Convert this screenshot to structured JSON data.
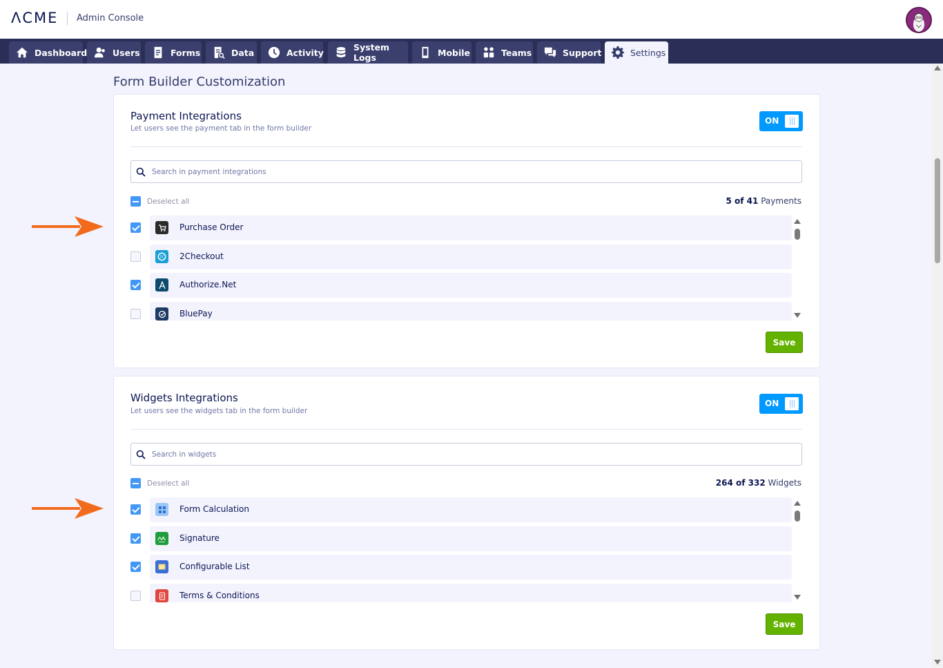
{
  "header": {
    "logo": "ΛCME",
    "console_title": "Admin Console"
  },
  "nav": {
    "tabs": [
      {
        "label": "Dashboard",
        "icon": "home-icon"
      },
      {
        "label": "Users",
        "icon": "users-icon"
      },
      {
        "label": "Forms",
        "icon": "forms-icon"
      },
      {
        "label": "Data",
        "icon": "data-icon"
      },
      {
        "label": "Activity",
        "icon": "clock-icon"
      },
      {
        "label": "System Logs",
        "icon": "database-icon"
      },
      {
        "label": "Mobile",
        "icon": "mobile-icon"
      },
      {
        "label": "Teams",
        "icon": "teams-icon"
      },
      {
        "label": "Support",
        "icon": "support-icon"
      },
      {
        "label": "Settings",
        "icon": "gear-icon",
        "active": true
      }
    ]
  },
  "page": {
    "title": "Form Builder Customization"
  },
  "payments": {
    "title": "Payment Integrations",
    "subtitle": "Let users see the payment tab in the form builder",
    "toggle_label": "ON",
    "search_placeholder": "Search in payment integrations",
    "deselect_label": "Deselect all",
    "count_bold": "5 of 41",
    "count_suffix": " Payments",
    "items": [
      {
        "label": "Purchase Order",
        "checked": true,
        "icon": "cart-icon",
        "icon_color": "#2b2b2b"
      },
      {
        "label": "2Checkout",
        "checked": false,
        "icon": "2checkout-icon",
        "icon_color": "#1a9fd6"
      },
      {
        "label": "Authorize.Net",
        "checked": true,
        "icon": "authorize-net-icon",
        "icon_color": "#0e4c6e"
      },
      {
        "label": "BluePay",
        "checked": false,
        "icon": "bluepay-icon",
        "icon_color": "#1d3b63"
      }
    ],
    "save_label": "Save"
  },
  "widgets": {
    "title": "Widgets Integrations",
    "subtitle": "Let users see the widgets tab in the form builder",
    "toggle_label": "ON",
    "search_placeholder": "Search in widgets",
    "deselect_label": "Deselect all",
    "count_bold": "264 of 332",
    "count_suffix": " Widgets",
    "items": [
      {
        "label": "Form Calculation",
        "checked": true,
        "icon": "calculator-icon",
        "icon_color": "#9cc7f5"
      },
      {
        "label": "Signature",
        "checked": true,
        "icon": "signature-icon",
        "icon_color": "#1f9d3a"
      },
      {
        "label": "Configurable List",
        "checked": true,
        "icon": "list-icon",
        "icon_color": "#3b6fd6"
      },
      {
        "label": "Terms & Conditions",
        "checked": false,
        "icon": "terms-icon",
        "icon_color": "#e0473f"
      }
    ],
    "save_label": "Save"
  },
  "colors": {
    "nav_bg": "#2b2f57",
    "toggle_on": "#0099ff",
    "save_green": "#64b200",
    "arrow_orange": "#f26b1d"
  }
}
